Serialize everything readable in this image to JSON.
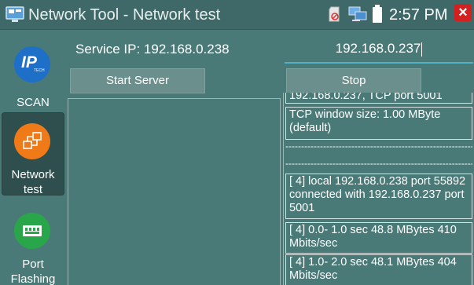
{
  "window": {
    "title": "Network Tool - Network test",
    "clock": "2:57 PM",
    "close_symbol": "×"
  },
  "colors": {
    "background": "#4a7a78",
    "title_bar": "#3e6968",
    "close": "#d32020",
    "input_underline": "#4fb0c8",
    "active_item": "#2f4f4e"
  },
  "sidebar": {
    "items": [
      {
        "label": "SCAN",
        "icon": "ip-scan-icon",
        "icon_text": "IP",
        "icon_sub": "TECH"
      },
      {
        "label": "Network test",
        "icon": "network-icon",
        "active": true
      },
      {
        "label": "Port Flashing",
        "icon": "port-icon"
      }
    ]
  },
  "server": {
    "service_ip_label": "Service IP: 192.168.0.238",
    "target_ip_value": "192.168.0.237",
    "start_label": "Start Server",
    "stop_label": "Stop"
  },
  "log": {
    "lines": [
      "192.168.0.237, TCP port 5001",
      "TCP window size: 1.00 MByte (default)",
      "------------------------------------------------------------",
      "[  4] local 192.168.0.238 port 55892 connected with 192.168.0.237 port 5001",
      "[  4]  0.0- 1.0 sec  48.8 MBytes  410 Mbits/sec",
      "[  4]  1.0- 2.0 sec  48.1 MBytes  404 Mbits/sec"
    ]
  }
}
